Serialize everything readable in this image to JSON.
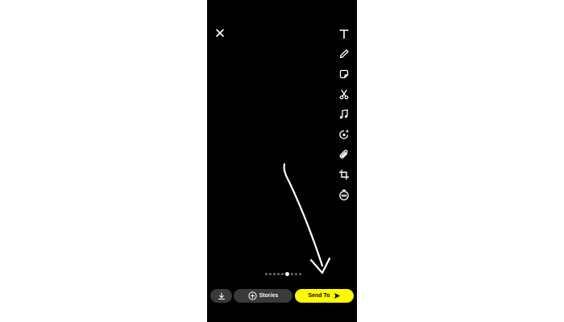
{
  "header": {
    "close_icon": "close-icon"
  },
  "toolbar": {
    "tools": [
      {
        "name": "text",
        "icon": "text-icon"
      },
      {
        "name": "draw",
        "icon": "pencil-icon"
      },
      {
        "name": "sticker",
        "icon": "sticker-icon"
      },
      {
        "name": "scissors",
        "icon": "scissors-icon"
      },
      {
        "name": "music",
        "icon": "music-note-icon"
      },
      {
        "name": "lens",
        "icon": "lens-sparkle-icon"
      },
      {
        "name": "attach",
        "icon": "paperclip-icon"
      },
      {
        "name": "crop",
        "icon": "crop-icon"
      },
      {
        "name": "timer",
        "icon": "infinity-timer-icon"
      }
    ]
  },
  "pager": {
    "count": 9,
    "active_index": 5
  },
  "bottom_bar": {
    "save_icon": "download-icon",
    "stories_label": "Stories",
    "send_label": "Send To"
  },
  "colors": {
    "background": "#000000",
    "accent_yellow": "#fffc00",
    "button_gray": "#3a3a3a"
  }
}
